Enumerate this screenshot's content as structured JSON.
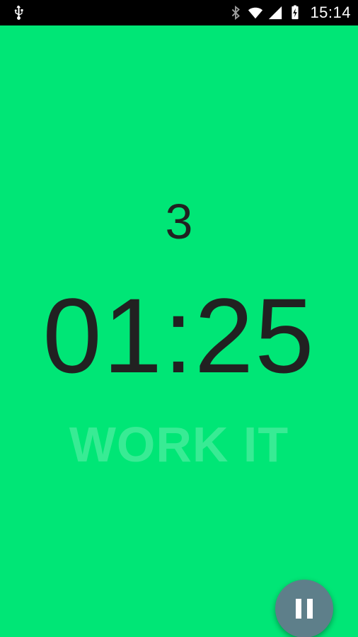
{
  "status_bar": {
    "time": "15:14",
    "icons": [
      "usb-icon",
      "bluetooth-icon",
      "wifi-icon",
      "signal-icon",
      "battery-charging-icon"
    ]
  },
  "workout": {
    "round": "3",
    "timer": "01:25",
    "phase": "WORK IT"
  },
  "controls": {
    "pause_icon": "pause-icon"
  },
  "colors": {
    "background": "#00E676",
    "text": "#212121",
    "fab": "#5E7F8A"
  }
}
